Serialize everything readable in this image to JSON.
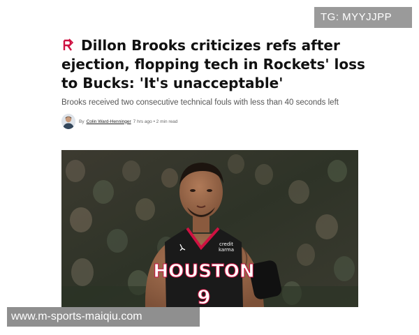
{
  "watermark_top": "TG: MYYJJPP",
  "article": {
    "team_logo_icon": "rockets-logo-icon",
    "headline": "Dillon Brooks criticizes refs after ejection, flopping tech in Rockets' loss to Bucks: 'It's unacceptable'",
    "subheadline": "Brooks received two consecutive technical fouls with less than 40 seconds left",
    "byline": {
      "prefix": "By",
      "author": "Colin Ward-Henninger",
      "meta": "7 hrs ago • 2 min read"
    },
    "photo": {
      "jersey_text": "HOUSTON",
      "jersey_number": "9",
      "sponsor_line1": "credit",
      "sponsor_line2": "karma"
    }
  },
  "colors": {
    "rockets_red": "#ce1141",
    "jersey_black": "#1a1a1a"
  },
  "watermark_bottom": "www.m-sports-maiqiu.com"
}
